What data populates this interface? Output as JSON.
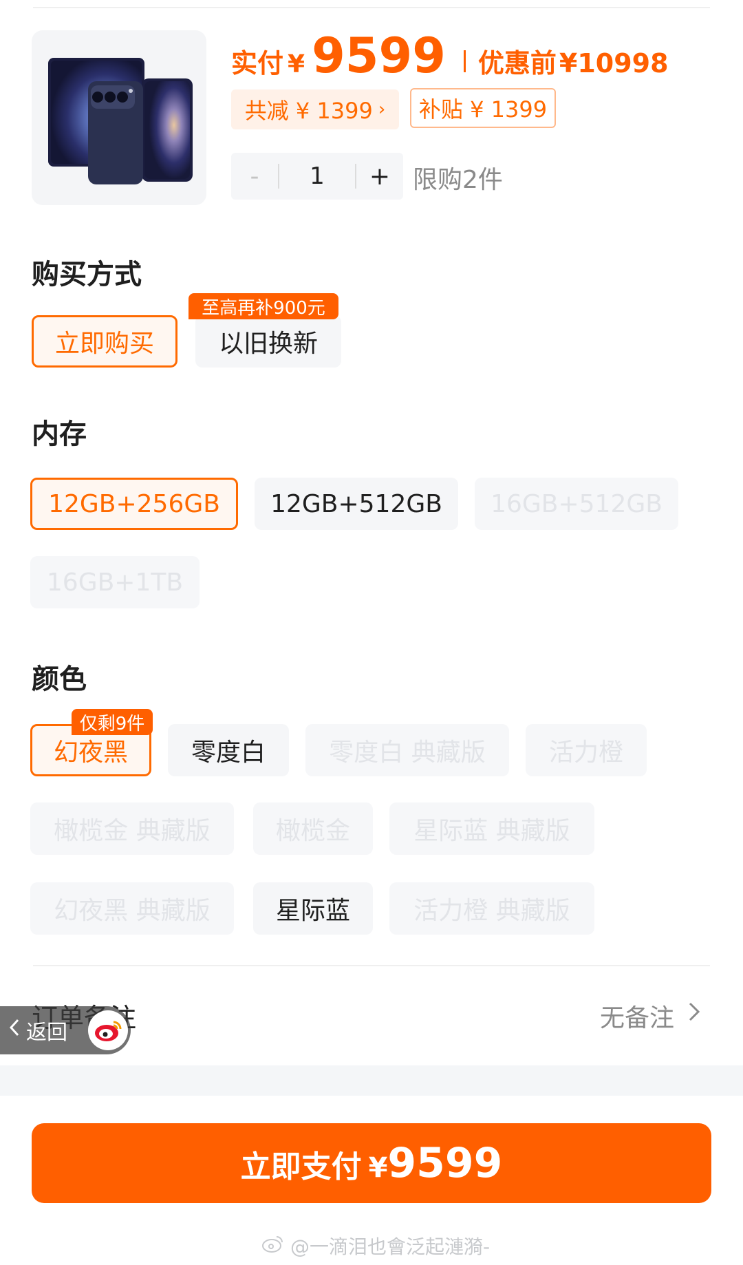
{
  "price": {
    "paid_label": "实付",
    "currency": "¥",
    "paid_amount": "9599",
    "original_label": "优惠前",
    "original_amount": "¥10998"
  },
  "tags": {
    "discount": "共减 ¥ 1399",
    "subsidy": "补贴 ¥ 1399"
  },
  "quantity": {
    "minus": "-",
    "value": "1",
    "plus": "+",
    "limit": "限购2件"
  },
  "purchase": {
    "title": "购买方式",
    "options": [
      "立即购买",
      "以旧换新"
    ],
    "trade_in_tag": "至高再补900元"
  },
  "memory": {
    "title": "内存",
    "options": [
      "12GB+256GB",
      "12GB+512GB",
      "16GB+512GB",
      "16GB+1TB"
    ]
  },
  "color": {
    "title": "颜色",
    "options": [
      "幻夜黑",
      "零度白",
      "零度白 典藏版",
      "活力橙",
      "橄榄金 典藏版",
      "橄榄金",
      "星际蓝 典藏版",
      "幻夜黑 典藏版",
      "星际蓝",
      "活力橙 典藏版"
    ],
    "stock_tag": "仅剩9件"
  },
  "remark": {
    "label": "订单备注",
    "value": "无备注"
  },
  "back": {
    "label": "返回"
  },
  "pay": {
    "label": "立即支付",
    "currency": "¥",
    "amount": "9599"
  },
  "watermark": "@一滴泪也會泛起漣漪-",
  "colors": {
    "accent": "#ff5f00",
    "selected_bg": "#fff7f1",
    "chip_bg": "#f5f6f8",
    "disabled_text": "#e2e4e8"
  }
}
